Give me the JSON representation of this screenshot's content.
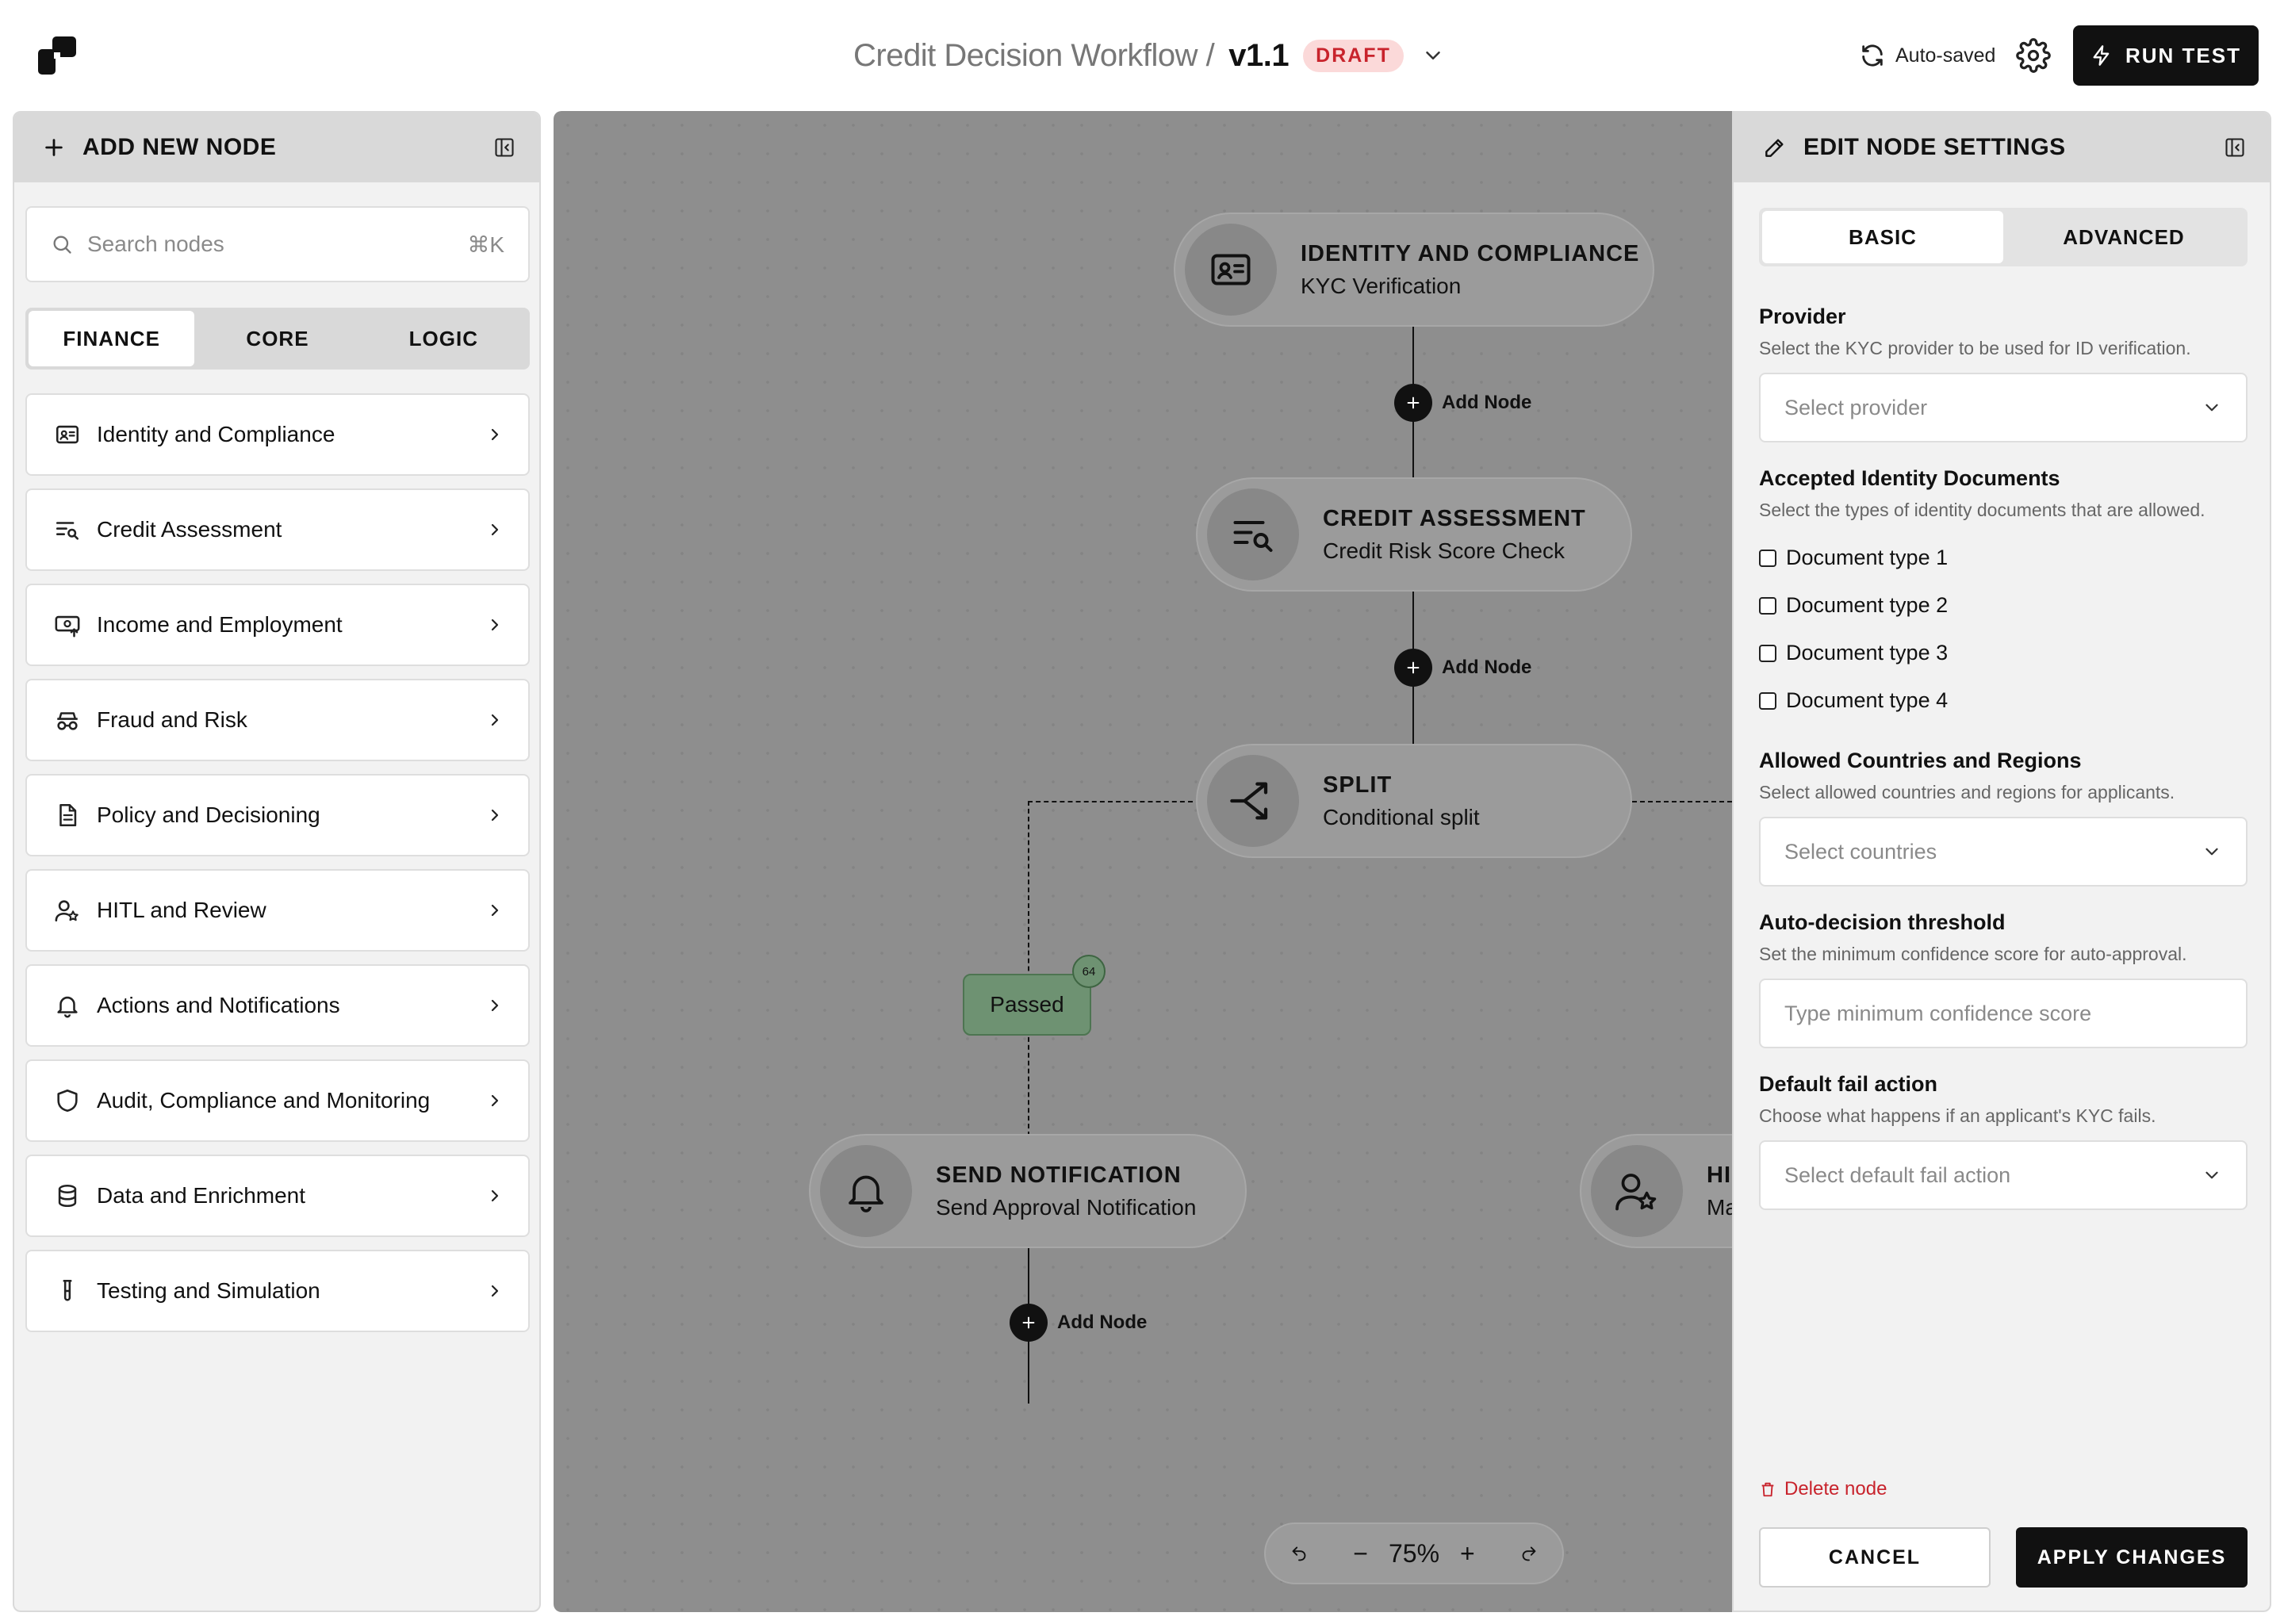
{
  "header": {
    "workflow_name": "Credit Decision Workflow /",
    "version": "v1.1",
    "status_badge": "DRAFT",
    "autosave_label": "Auto-saved",
    "run_test_label": "RUN TEST"
  },
  "left_panel": {
    "title": "ADD NEW NODE",
    "search_placeholder": "Search nodes",
    "search_shortcut": "⌘K",
    "tabs": [
      {
        "label": "FINANCE",
        "active": true
      },
      {
        "label": "CORE",
        "active": false
      },
      {
        "label": "LOGIC",
        "active": false
      }
    ],
    "categories": [
      {
        "label": "Identity and Compliance",
        "icon": "id-card-icon"
      },
      {
        "label": "Credit Assessment",
        "icon": "list-search-icon"
      },
      {
        "label": "Income and Employment",
        "icon": "cash-upload-icon"
      },
      {
        "label": "Fraud and Risk",
        "icon": "spy-icon"
      },
      {
        "label": "Policy and Decisioning",
        "icon": "document-icon"
      },
      {
        "label": "HITL and Review",
        "icon": "user-star-icon"
      },
      {
        "label": "Actions and Notifications",
        "icon": "bell-icon"
      },
      {
        "label": "Audit, Compliance and Monitoring",
        "icon": "shield-icon"
      },
      {
        "label": "Data and Enrichment",
        "icon": "database-icon"
      },
      {
        "label": "Testing and Simulation",
        "icon": "test-tube-icon"
      }
    ]
  },
  "canvas": {
    "nodes": [
      {
        "title": "IDENTITY AND COMPLIANCE",
        "subtitle": "KYC Verification",
        "icon": "id-card-icon"
      },
      {
        "title": "CREDIT ASSESSMENT",
        "subtitle": "Credit Risk Score Check",
        "icon": "list-search-icon"
      },
      {
        "title": "SPLIT",
        "subtitle": "Conditional split",
        "icon": "split-arrow-icon"
      },
      {
        "title": "SEND NOTIFICATION",
        "subtitle": "Send Approval Notification",
        "icon": "bell-icon"
      },
      {
        "title": "HI",
        "subtitle": "Ma",
        "icon": "user-star-icon"
      }
    ],
    "add_node_label": "Add Node",
    "branch_label": "Passed",
    "branch_count": "64",
    "zoom_level": "75%",
    "zoom_out": "−",
    "zoom_in": "+"
  },
  "right_panel": {
    "title": "EDIT NODE SETTINGS",
    "tabs": [
      {
        "label": "BASIC",
        "active": true
      },
      {
        "label": "ADVANCED",
        "active": false
      }
    ],
    "provider": {
      "label": "Provider",
      "help": "Select the KYC provider to be used for ID verification.",
      "placeholder": "Select provider"
    },
    "documents": {
      "label": "Accepted Identity Documents",
      "help": "Select the types of identity documents that are allowed.",
      "options": [
        "Document type 1",
        "Document type 2",
        "Document type 3",
        "Document type 4"
      ]
    },
    "countries": {
      "label": "Allowed Countries and Regions",
      "help": "Select allowed countries and regions for applicants.",
      "placeholder": "Select countries"
    },
    "threshold": {
      "label": "Auto-decision threshold",
      "help": "Set the minimum confidence score for auto-approval.",
      "placeholder": "Type minimum confidence score"
    },
    "fail_action": {
      "label": "Default fail action",
      "help": "Choose what happens if an applicant's KYC fails.",
      "placeholder": "Select default fail action"
    },
    "delete_label": "Delete node",
    "cancel_label": "CANCEL",
    "apply_label": "APPLY CHANGES"
  }
}
